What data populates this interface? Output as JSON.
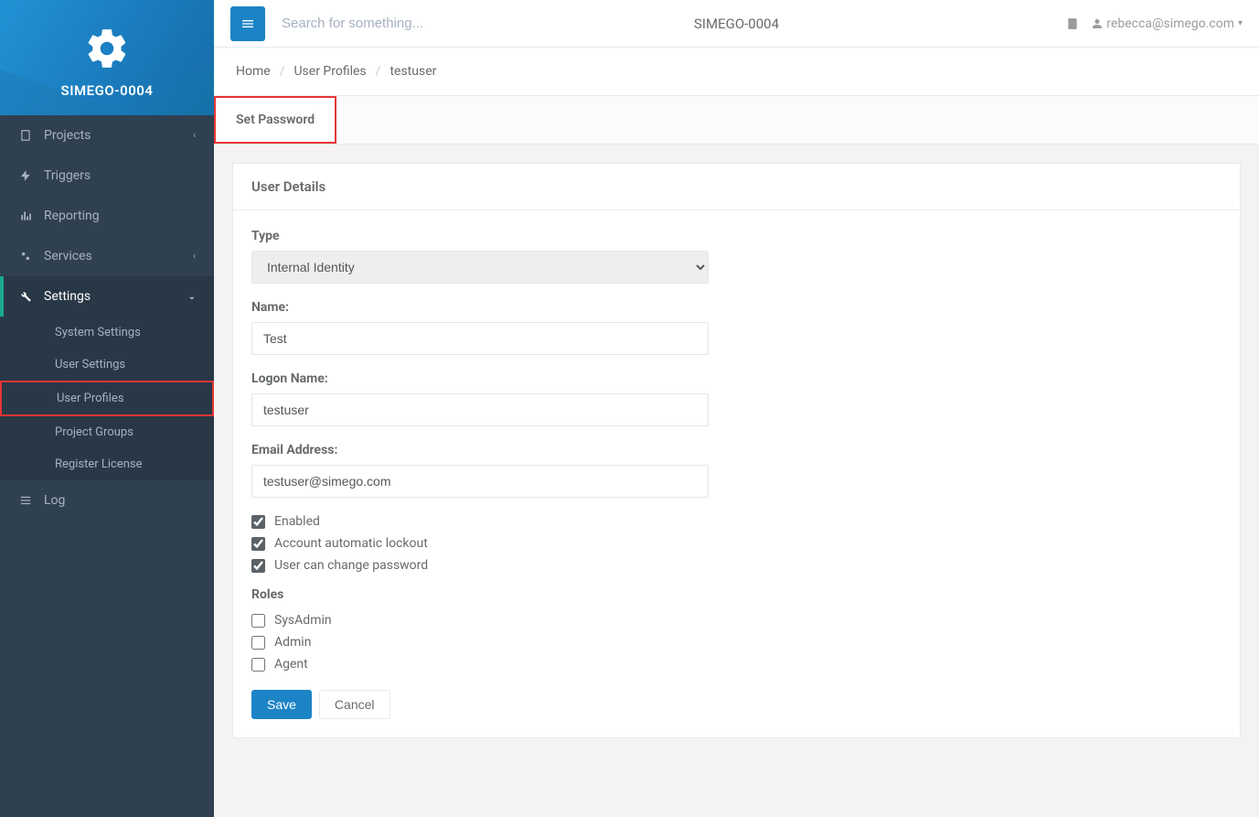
{
  "app": {
    "name": "SIMEGO-0004",
    "title": "SIMEGO-0004"
  },
  "topbar": {
    "search_placeholder": "Search for something...",
    "user_email": "rebecca@simego.com"
  },
  "sidebar": {
    "items": [
      {
        "label": "Projects",
        "icon": "book-icon",
        "expandable": true
      },
      {
        "label": "Triggers",
        "icon": "bolt-icon",
        "expandable": false
      },
      {
        "label": "Reporting",
        "icon": "chart-icon",
        "expandable": false
      },
      {
        "label": "Services",
        "icon": "cogs-icon",
        "expandable": true
      },
      {
        "label": "Settings",
        "icon": "wrench-icon",
        "expandable": true,
        "active": true,
        "children": [
          {
            "label": "System Settings"
          },
          {
            "label": "User Settings"
          },
          {
            "label": "User Profiles",
            "highlighted": true
          },
          {
            "label": "Project Groups"
          },
          {
            "label": "Register License"
          }
        ]
      },
      {
        "label": "Log",
        "icon": "list-icon",
        "expandable": false
      }
    ]
  },
  "breadcrumb": [
    "Home",
    "User Profiles",
    "testuser"
  ],
  "tabs": {
    "set_password": "Set Password"
  },
  "panel": {
    "title": "User Details",
    "type_label": "Type",
    "type_value": "Internal Identity",
    "name_label": "Name:",
    "name_value": "Test",
    "logon_label": "Logon Name:",
    "logon_value": "testuser",
    "email_label": "Email Address:",
    "email_value": "testuser@simego.com",
    "enabled_label": "Enabled",
    "enabled_checked": true,
    "lockout_label": "Account automatic lockout",
    "lockout_checked": true,
    "changepw_label": "User can change password",
    "changepw_checked": true,
    "roles_title": "Roles",
    "roles": [
      {
        "label": "SysAdmin",
        "checked": false
      },
      {
        "label": "Admin",
        "checked": false
      },
      {
        "label": "Agent",
        "checked": false
      }
    ],
    "save_label": "Save",
    "cancel_label": "Cancel"
  }
}
